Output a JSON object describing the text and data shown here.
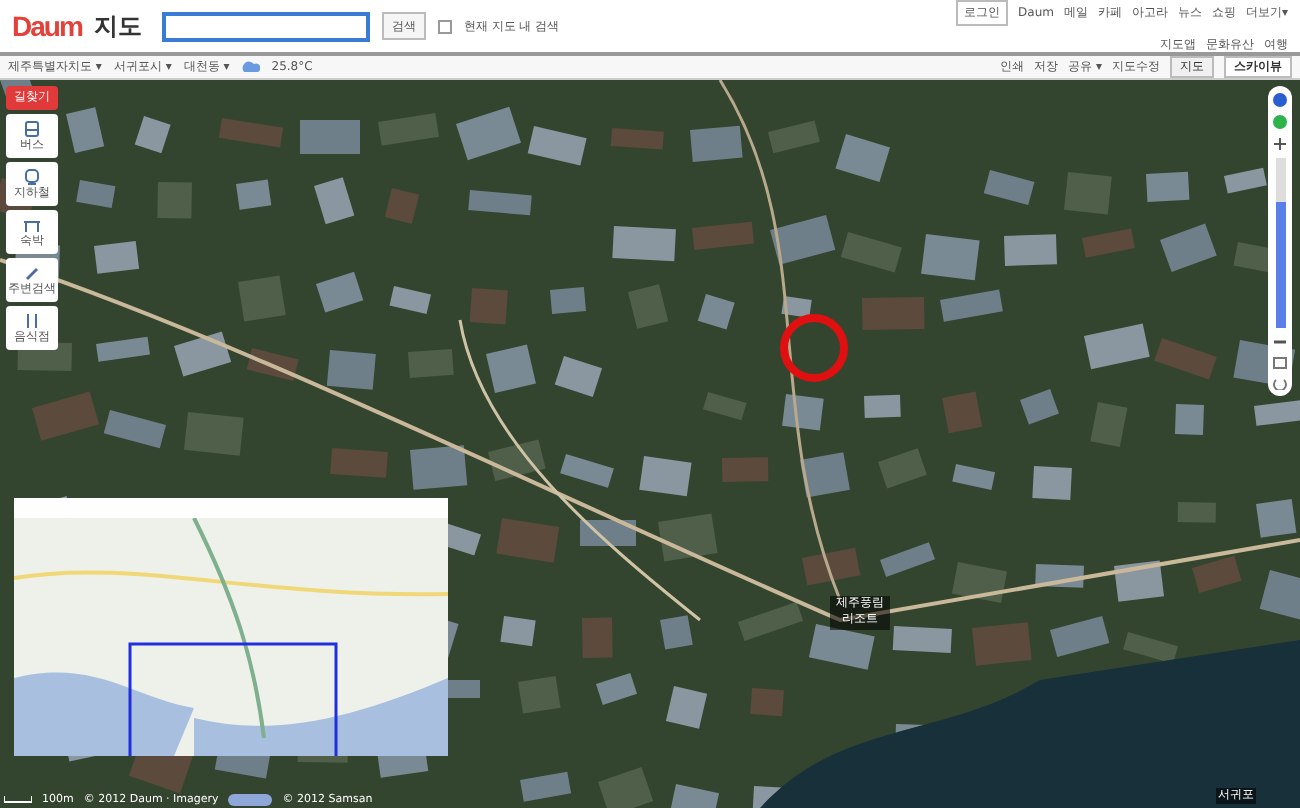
{
  "header": {
    "logo": "Daum",
    "service": "지도",
    "search_button": "검색",
    "scope": {
      "label": "현재 지도 내 검색",
      "checked": false
    },
    "login": "로그인",
    "links": [
      "Daum",
      "메일",
      "카페",
      "아고라",
      "뉴스",
      "쇼핑",
      "더보기▾"
    ],
    "sublinks": [
      "지도앱",
      "문화유산",
      "여행"
    ]
  },
  "toolbar": {
    "regions": [
      "제주특별자치도 ▾",
      "서귀포시 ▾",
      "대천동 ▾"
    ],
    "weather": "25.8°C",
    "actions": [
      "인쇄",
      "저장",
      "공유 ▾",
      "지도수정"
    ],
    "tabs": [
      {
        "label": "지도",
        "selected": false
      },
      {
        "label": "스카이뷰",
        "selected": true
      }
    ]
  },
  "side_menu": [
    {
      "label": "길찾기",
      "kind": "primary"
    },
    {
      "label": "버스",
      "kind": "bus"
    },
    {
      "label": "지하철",
      "kind": "subway"
    },
    {
      "label": "숙박",
      "kind": "lodging"
    },
    {
      "label": "주변검색",
      "kind": "nearby"
    },
    {
      "label": "음식점",
      "kind": "food"
    }
  ],
  "map": {
    "labels": [
      {
        "text": "제주풍림 리조트"
      }
    ],
    "zoom": {
      "level": 0.74
    },
    "place": "서귀포"
  },
  "footer": {
    "scale": "100m",
    "copyright": "© 2012 Daum · Imagery",
    "partner": "© 2012 Samsan"
  }
}
